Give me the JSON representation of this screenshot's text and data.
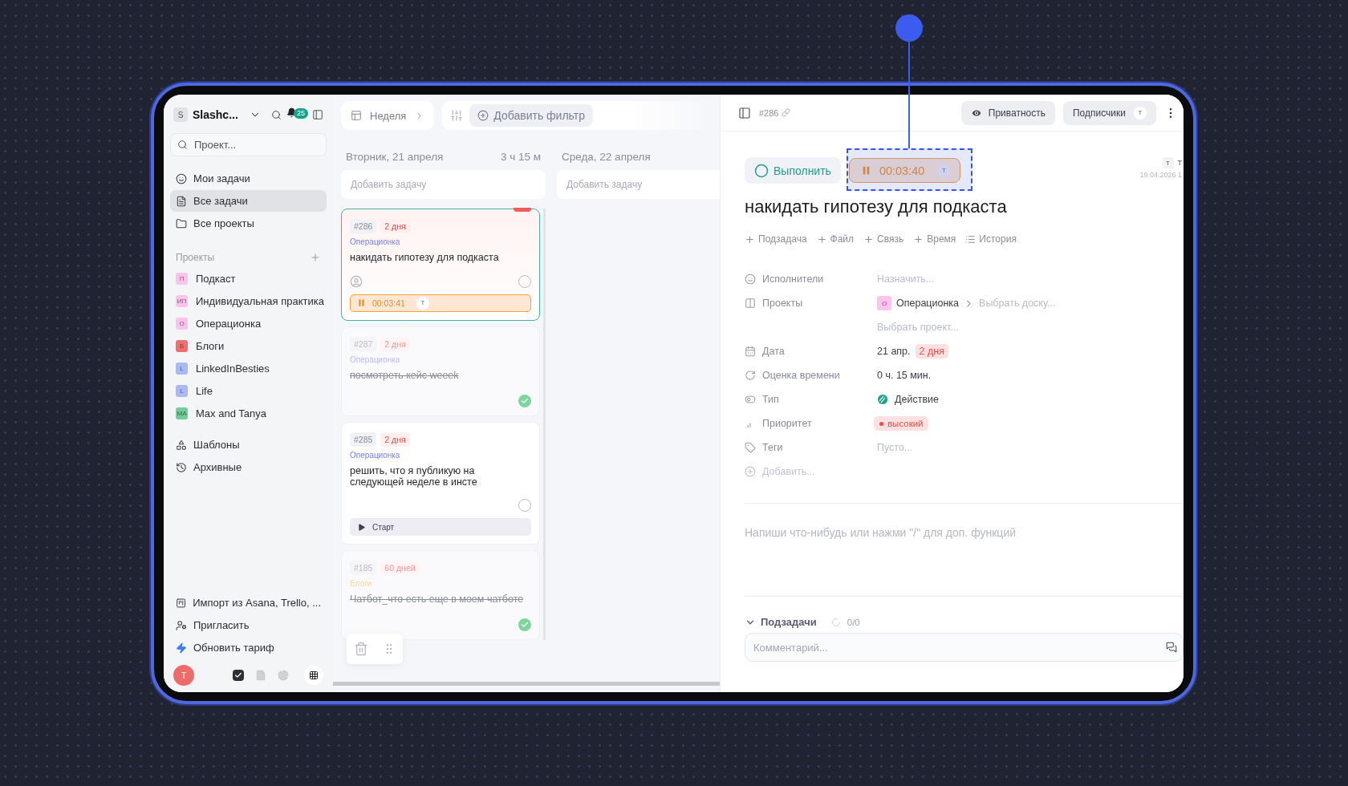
{
  "sidebar": {
    "workspace": {
      "initial": "S",
      "name": "Slashc..."
    },
    "notifications": "25",
    "search": {
      "placeholder": "Проект..."
    },
    "nav": [
      {
        "label": "Мои задачи",
        "selected": false
      },
      {
        "label": "Все задачи",
        "selected": true
      },
      {
        "label": "Все проекты",
        "selected": false
      }
    ],
    "projects_title": "Проекты",
    "projects": [
      {
        "initials": "П",
        "name": "Подкаст",
        "color": "#fac3ea"
      },
      {
        "initials": "ИП",
        "name": "Индивидуальная практика",
        "color": "#fac3ea"
      },
      {
        "initials": "О",
        "name": "Операционка",
        "color": "#fac3ea"
      },
      {
        "initials": "Б",
        "name": "Блоги",
        "color": "#ef6f6f"
      },
      {
        "initials": "L",
        "name": "LinkedInBesties",
        "color": "#aab9f6"
      },
      {
        "initials": "L",
        "name": "Life",
        "color": "#aab9f6"
      },
      {
        "initials": "MA",
        "name": "Max and Tanya",
        "color": "#6fcf97"
      }
    ],
    "links": [
      {
        "label": "Шаблоны"
      },
      {
        "label": "Архивные"
      }
    ],
    "footer_links": [
      {
        "label": "Импорт из Asana, Trello, ..."
      },
      {
        "label": "Пригласить"
      },
      {
        "label": "Обновить тариф"
      }
    ],
    "user": {
      "initial": "Т"
    },
    "bottom_tabs": [
      {
        "selected": true
      },
      {
        "selected": false
      },
      {
        "selected": false
      }
    ]
  },
  "board": {
    "view": "Неделя",
    "filter": "Добавить фильтр",
    "days": [
      {
        "title": "Вторник, 21 апреля",
        "total": "3 ч 15 м",
        "add": "Добавить задачу",
        "cards": [
          {
            "kind": "timer",
            "id": "#286",
            "due": "2 дня",
            "project": "Операционка",
            "color": "#7b80f2",
            "title": "накидать гипотезу для подкаста",
            "done": false,
            "active": true,
            "flagged": true,
            "timer": "00:03:41",
            "timer_user": "Т"
          },
          {
            "kind": "plain",
            "id": "#287",
            "due": "2 дня",
            "project": "Операционка",
            "color": "#b9bcf7",
            "title": "посмотреть кейс weeek",
            "done": true,
            "active": false,
            "flagged": false
          },
          {
            "kind": "start",
            "id": "#285",
            "due": "2 дня",
            "project": "Операционка",
            "color": "#7b80f2",
            "title": "решить, что я публикую на следующей неделе в инсте",
            "done": false,
            "active": false,
            "flagged": false,
            "start": "Старт"
          },
          {
            "kind": "plain",
            "id": "#185",
            "due": "60 дней",
            "project": "Блоги",
            "color": "#f8d99a",
            "title": "Чатбот_что есть еще в моем чатботе",
            "done": true,
            "active": false,
            "flagged": false
          }
        ]
      },
      {
        "title": "Среда, 22 апреля",
        "add": "Добавить задачу"
      }
    ]
  },
  "task": {
    "id": "#286",
    "privacy": "Приватность",
    "subscribers": "Подписчики",
    "subscriber": "Т",
    "complete": "Выполнить",
    "timer": "00:03:40",
    "timer_user": "Т",
    "author": "Т",
    "author_name": "Т",
    "created": "19.04.2026 1",
    "title": "накидать гипотезу для подкаста",
    "actions": [
      {
        "label": "Подзадача",
        "kind": "add"
      },
      {
        "label": "Файл",
        "kind": "add"
      },
      {
        "label": "Связь",
        "kind": "add"
      },
      {
        "label": "Время",
        "kind": "add"
      },
      {
        "label": "История",
        "kind": "history"
      }
    ],
    "properties": [
      {
        "label": "Исполнители",
        "kind": "placeholder",
        "value": "Назначить..."
      },
      {
        "label": "Проекты",
        "kind": "project",
        "initial": "О",
        "value": "Операционка",
        "extra": "Выбрать доску...",
        "more": "Выбрать проект..."
      },
      {
        "label": "Дата",
        "kind": "date",
        "value": "21 апр.",
        "badge": "2 дня"
      },
      {
        "label": "Оценка времени",
        "kind": "text",
        "value": "0 ч. 15 мин."
      },
      {
        "label": "Тип",
        "kind": "type",
        "value": "Действие"
      },
      {
        "label": "Приоритет",
        "kind": "priority",
        "value": "высокий"
      },
      {
        "label": "Теги",
        "kind": "placeholder",
        "value": "Пусто..."
      }
    ],
    "add_property": "Добавить...",
    "editor_placeholder": "Напиши что-нибудь или нажми \"/\" для доп. функций",
    "subtasks": {
      "label": "Подзадачи",
      "count": "0/0",
      "expanded": true
    },
    "comment": {
      "placeholder": "Комментарий..."
    }
  }
}
